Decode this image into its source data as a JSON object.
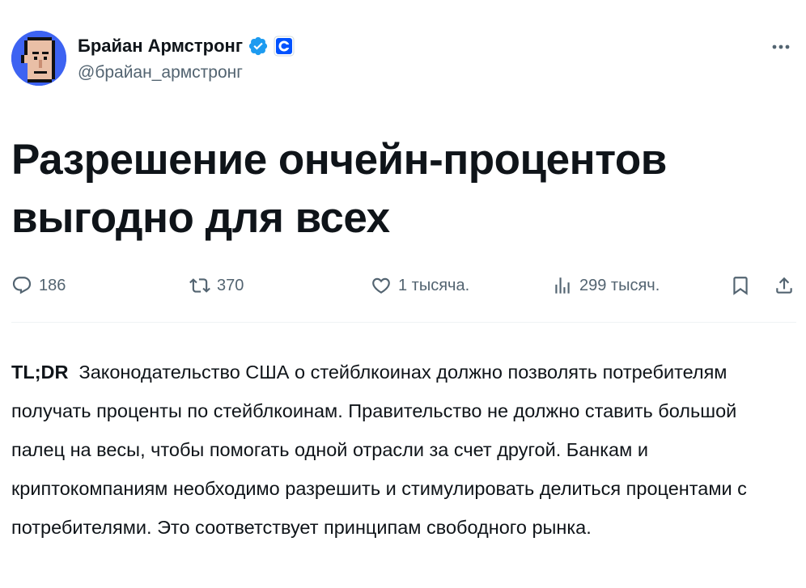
{
  "author": {
    "display_name": "Брайан Армстронг",
    "handle": "@брайан_армстронг",
    "verified_icon": "verified-badge-icon",
    "affiliation_icon": "coinbase-logo-icon"
  },
  "post": {
    "headline": "Разрешение ончейн-процентов выгодно для всех",
    "tldr_label": "TL;DR",
    "body": "Законодательство США о стейблкоинах должно позволять потребителям получать проценты по стейблкоинам. Правительство не должно ставить большой палец на весы, чтобы помогать одной отрасли за счет другой. Банкам и криптокомпаниям необходимо разрешить и стимулировать делиться процентами с потребителями. Это соответствует принципам свободного рынка."
  },
  "actions": {
    "replies": "186",
    "reposts": "370",
    "likes": "1 тысяча.",
    "views": "299 тысяч."
  },
  "colors": {
    "text": "#0f1419",
    "muted": "#536471",
    "verified": "#1d9bf0",
    "coinbase": "#0052ff"
  }
}
